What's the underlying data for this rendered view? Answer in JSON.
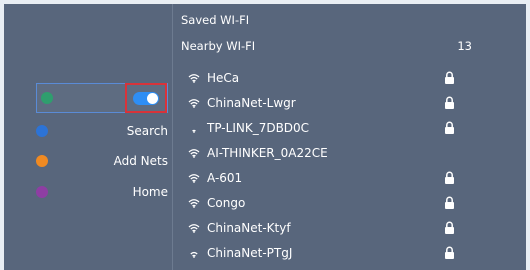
{
  "sidebar": {
    "items": [
      {
        "label": "",
        "dot_color": "#2f9e6e",
        "icon": "wifi-dot-icon"
      },
      {
        "label": "Search",
        "dot_color": "#2c73d6",
        "icon": "search-dot-icon"
      },
      {
        "label": "Add Nets",
        "dot_color": "#f08a22",
        "icon": "add-dot-icon"
      },
      {
        "label": "Home",
        "dot_color": "#8e3ea3",
        "icon": "home-dot-icon"
      }
    ],
    "wifi_toggle_on": true
  },
  "main": {
    "saved_header": "Saved WI-FI",
    "nearby_header": "Nearby WI-FI",
    "nearby_count": "13",
    "networks": [
      {
        "ssid": "HeCa",
        "locked": true,
        "signal": "strong"
      },
      {
        "ssid": "ChinaNet-Lwgr",
        "locked": true,
        "signal": "strong"
      },
      {
        "ssid": "TP-LINK_7DBD0C",
        "locked": true,
        "signal": "weak"
      },
      {
        "ssid": "AI-THINKER_0A22CE",
        "locked": false,
        "signal": "strong"
      },
      {
        "ssid": "A-601",
        "locked": true,
        "signal": "strong"
      },
      {
        "ssid": "Congo",
        "locked": true,
        "signal": "strong"
      },
      {
        "ssid": "ChinaNet-Ktyf",
        "locked": true,
        "signal": "strong"
      },
      {
        "ssid": "ChinaNet-PTgJ",
        "locked": true,
        "signal": "medium"
      }
    ]
  },
  "colors": {
    "background": "#58667c",
    "accent": "#2e8ef5",
    "highlight_border": "#d8333a"
  }
}
